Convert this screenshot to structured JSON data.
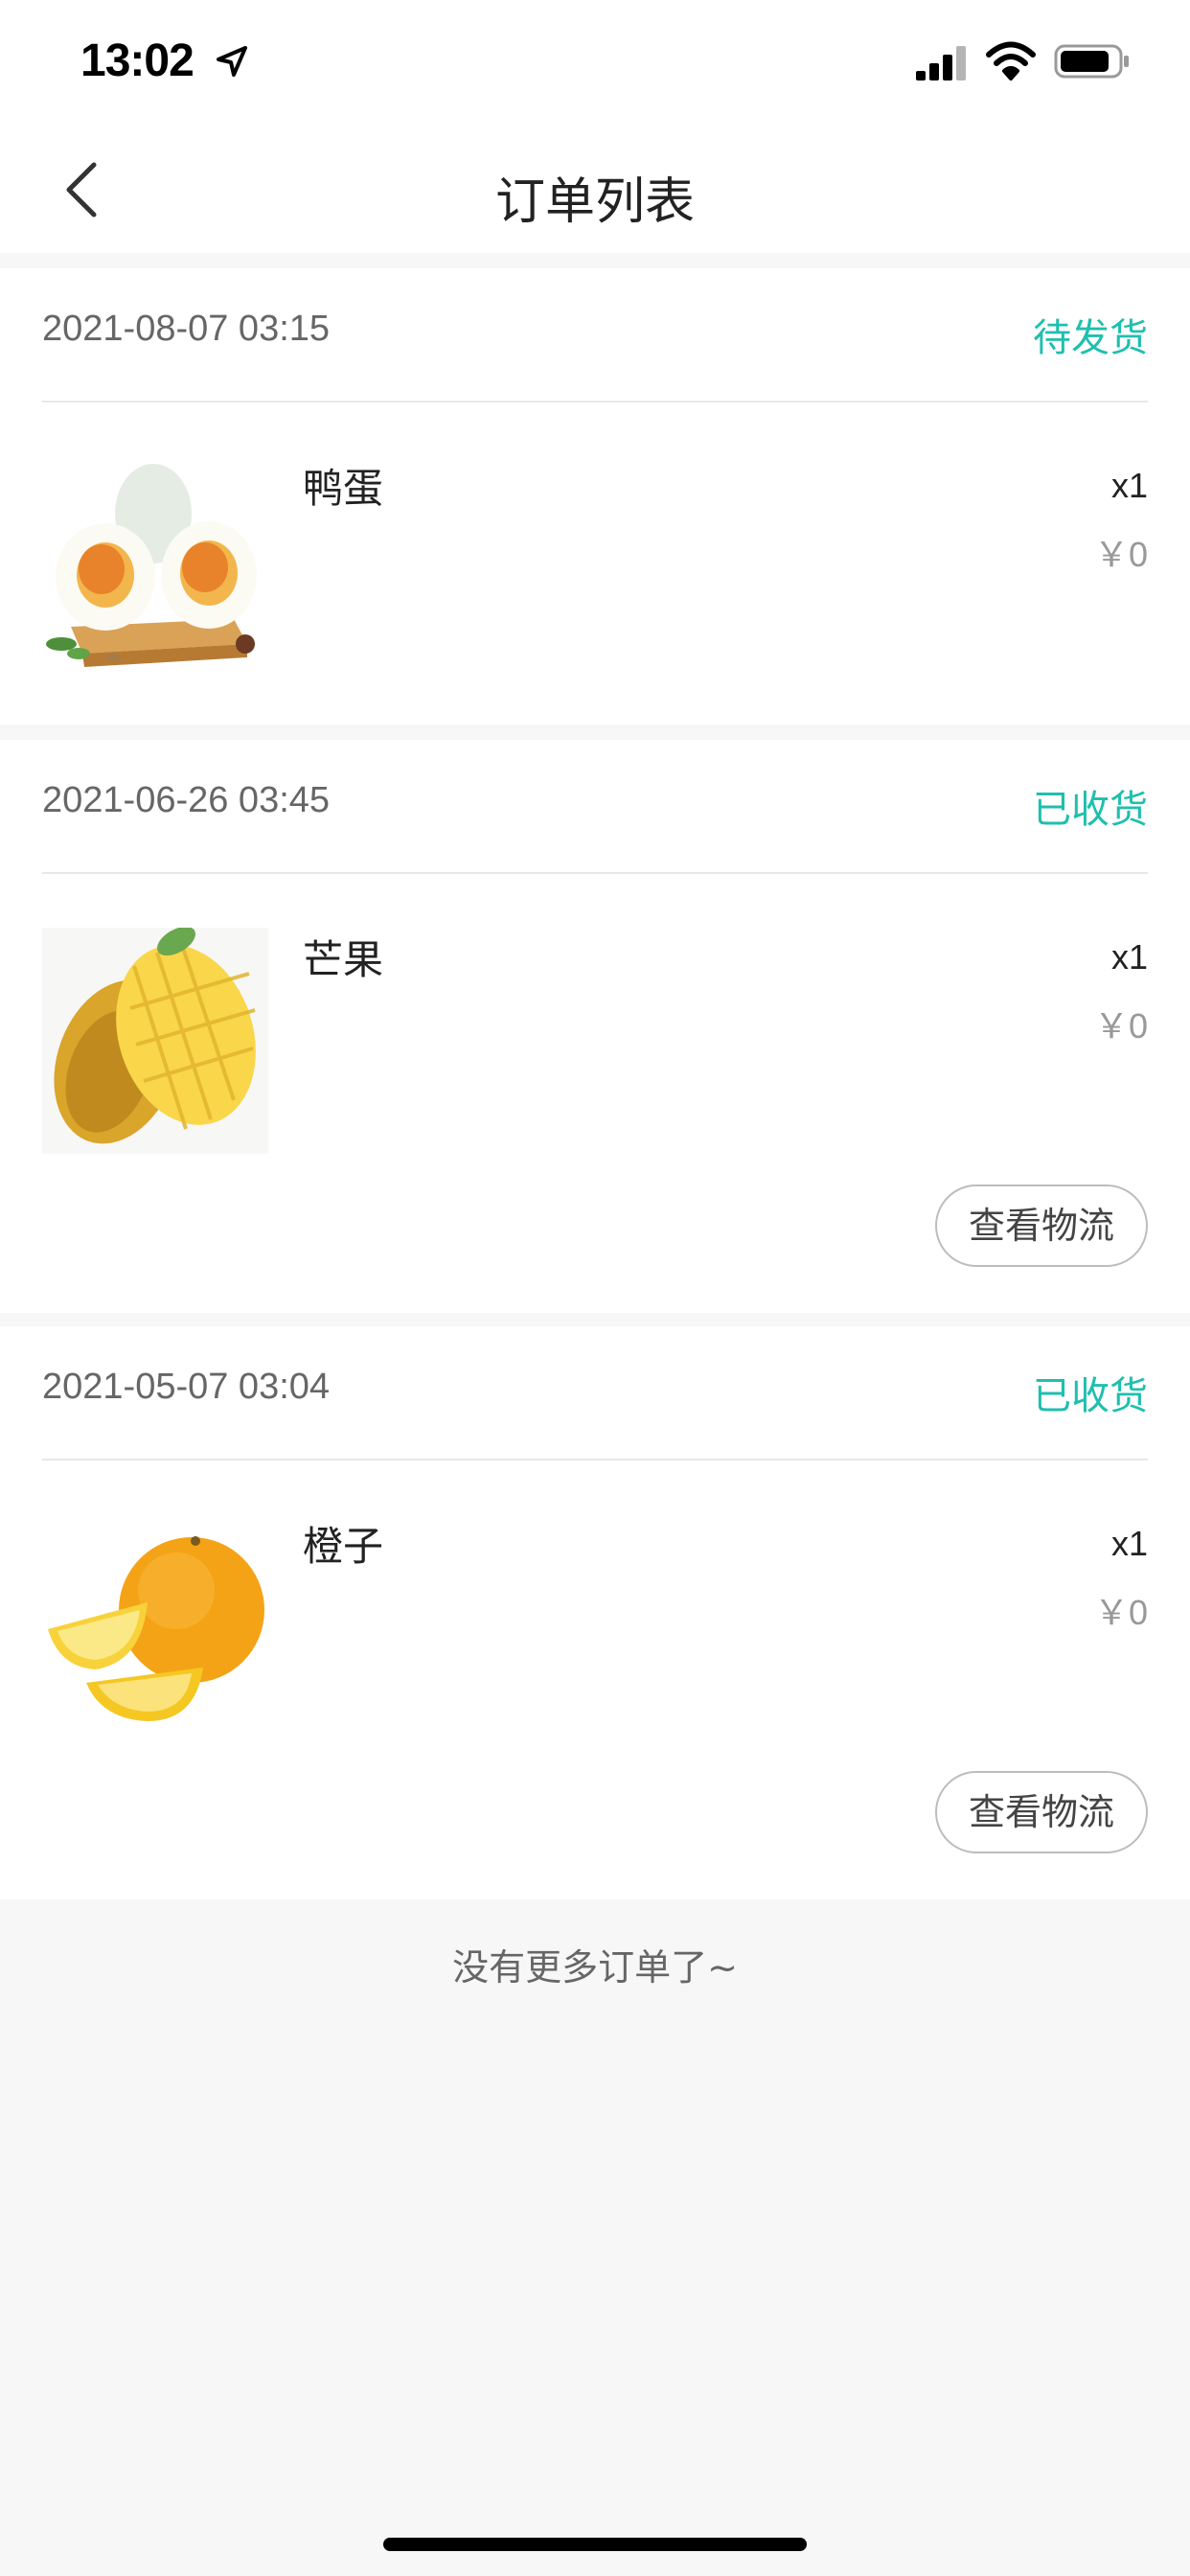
{
  "status_bar": {
    "time": "13:02"
  },
  "nav": {
    "title": "订单列表"
  },
  "orders": [
    {
      "date": "2021-08-07 03:15",
      "status": "待发货",
      "product": "鸭蛋",
      "qty": "x1",
      "price": "￥0"
    },
    {
      "date": "2021-06-26 03:45",
      "status": "已收货",
      "product": "芒果",
      "qty": "x1",
      "price": "￥0",
      "button": "查看物流"
    },
    {
      "date": "2021-05-07 03:04",
      "status": "已收货",
      "product": "橙子",
      "qty": "x1",
      "price": "￥0",
      "button": "查看物流"
    }
  ],
  "footer": {
    "no_more": "没有更多订单了~"
  },
  "colors": {
    "accent": "#1fbfae",
    "background": "#f7f7f7",
    "card": "#ffffff",
    "muted": "#999999"
  }
}
